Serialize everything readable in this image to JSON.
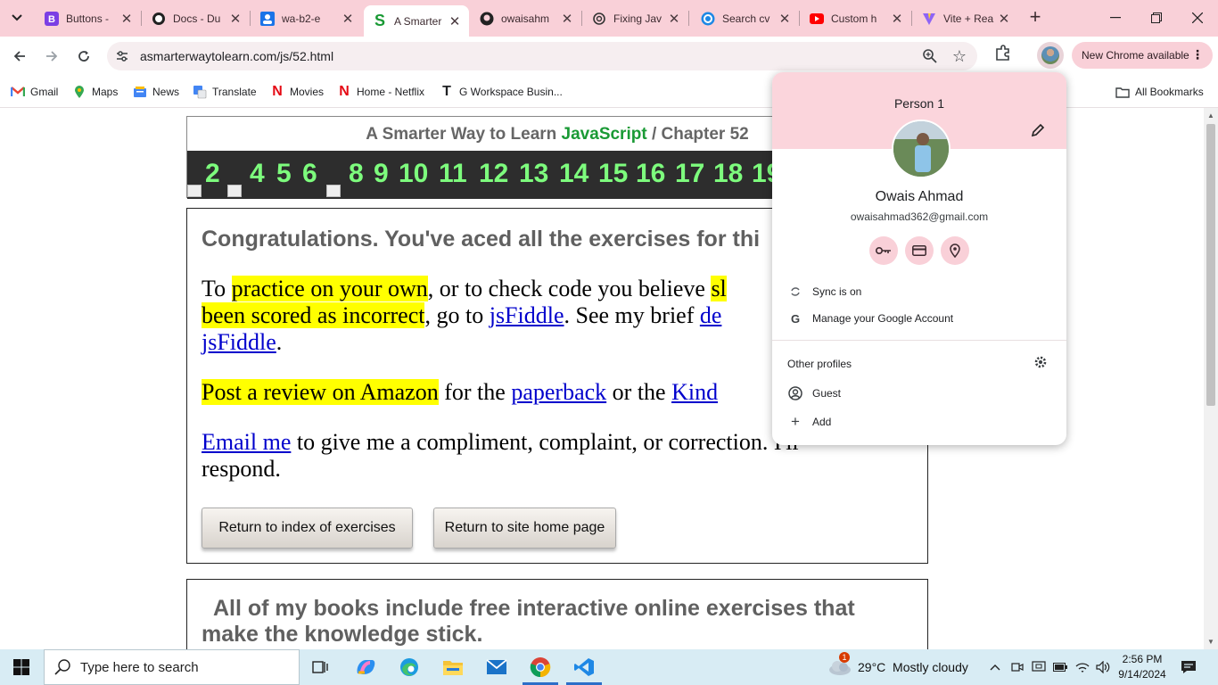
{
  "browser": {
    "tabs": [
      {
        "title": "Buttons -",
        "icon": "bootstrap-icon"
      },
      {
        "title": "Docs - Du",
        "icon": "docs-icon"
      },
      {
        "title": "wa-b2-e",
        "icon": "contact-icon"
      },
      {
        "title": "A Smarter",
        "icon": "smarter-way-icon",
        "active": true
      },
      {
        "title": "owaisahm",
        "icon": "github-icon"
      },
      {
        "title": "Fixing Jav",
        "icon": "openai-icon"
      },
      {
        "title": "Search cv",
        "icon": "copilot-icon"
      },
      {
        "title": "Custom h",
        "icon": "youtube-icon"
      },
      {
        "title": "Vite + Rea",
        "icon": "vite-icon"
      }
    ],
    "url": "asmarterwaytolearn.com/js/52.html",
    "new_chrome_label": "New Chrome available",
    "bookmarks": [
      {
        "label": "Gmail",
        "icon": "gmail-icon"
      },
      {
        "label": "Maps",
        "icon": "maps-icon"
      },
      {
        "label": "News",
        "icon": "news-icon"
      },
      {
        "label": "Translate",
        "icon": "translate-icon"
      },
      {
        "label": "Movies",
        "icon": "netflix-icon"
      },
      {
        "label": "Home - Netflix",
        "icon": "netflix-icon"
      },
      {
        "label": "G Workspace Busin...",
        "icon": "workspace-icon"
      }
    ],
    "all_bookmarks_label": "All Bookmarks"
  },
  "page": {
    "header": {
      "prefix": "A Smarter Way to Learn ",
      "brand": "JavaScript",
      "sep": " / ",
      "chapter": "Chapter 52"
    },
    "chapter_numbers": [
      "2",
      "4",
      "5",
      "6",
      "8",
      "9",
      "10",
      "11",
      "12",
      "13",
      "14",
      "15",
      "16",
      "17",
      "18",
      "19"
    ],
    "congrats": "Congratulations. You've aced all the exercises for thi",
    "para1": {
      "t1": "To ",
      "h1": "practice on your own",
      "t2": ", or to check code you believe ",
      "h2": "sl",
      "h3": "been scored as incorrect",
      "t3": ", go to ",
      "l1": "jsFiddle",
      "t4": ". See my brief ",
      "l2": "de",
      "l3": "jsFiddle",
      "t5": "."
    },
    "para2": {
      "h1": "Post a review on Amazon",
      "t1": " for the ",
      "l1": "paperback",
      "t2": " or the ",
      "l2": "Kind"
    },
    "para3": {
      "l1": "Email me",
      "t1": " to give me a compliment, complaint, or correction. I'll",
      "t2": "respond."
    },
    "buttons": {
      "index": "Return to index of exercises",
      "home": "Return to site home page"
    },
    "books_text": "All of my books include free interactive online exercises that make the knowledge stick."
  },
  "profile_menu": {
    "heading": "Person 1",
    "name": "Owais Ahmad",
    "email": "owaisahmad362@gmail.com",
    "sync": "Sync is on",
    "manage": "Manage your Google Account",
    "other_profiles": "Other profiles",
    "guest": "Guest",
    "add": "Add"
  },
  "taskbar": {
    "search_placeholder": "Type here to search",
    "weather": "29°C  Mostly cloudy",
    "weather_badge": "1",
    "time": "2:56 PM",
    "date": "9/14/2024"
  }
}
